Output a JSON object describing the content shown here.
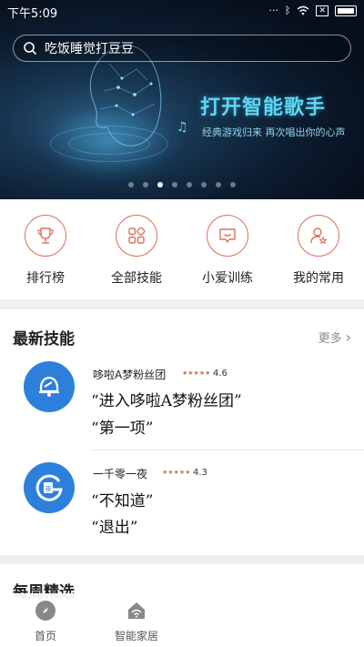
{
  "status_bar": {
    "time": "下午5:09",
    "battery_icon": "battery-icon",
    "wifi_icon": "wifi-icon",
    "bluetooth_icon": "bluetooth-icon"
  },
  "search": {
    "placeholder": "吃饭睡觉打豆豆",
    "icon": "search-icon"
  },
  "banner": {
    "title": "打开智能歌手",
    "subtitle": "经典游戏归来 再次唱出你的心声",
    "page_count": 8,
    "active_page": 3
  },
  "quick_entries": [
    {
      "label": "排行榜",
      "icon": "trophy-icon"
    },
    {
      "label": "全部技能",
      "icon": "grid-icon"
    },
    {
      "label": "小爱训练",
      "icon": "chat-bubble-icon"
    },
    {
      "label": "我的常用",
      "icon": "user-star-icon"
    }
  ],
  "latest": {
    "title": "最新技能",
    "more_label": "更多",
    "items": [
      {
        "name": "哆啦A梦粉丝团",
        "rating": "4.6",
        "stars": "★★★★★",
        "phrase1": "“进入哆啦A梦粉丝团”",
        "phrase2": "“第一项”",
        "logo_icon": "bell-icon",
        "logo_color": "#2d7fdc"
      },
      {
        "name": "一千零一夜",
        "rating": "4.3",
        "stars": "★★★★★",
        "phrase1": "“不知道”",
        "phrase2": "“退出”",
        "logo_icon": "book-g-icon",
        "logo_color": "#2d7fdc"
      }
    ]
  },
  "weekly": {
    "title": "每周精选"
  },
  "tabbar": {
    "tabs": [
      {
        "label": "首页",
        "icon": "compass-icon"
      },
      {
        "label": "智能家居",
        "icon": "smart-home-icon"
      }
    ]
  },
  "colors": {
    "accent": "#d8745a",
    "banner_text": "#5fd7f0",
    "logo_blue": "#2d7fdc"
  }
}
